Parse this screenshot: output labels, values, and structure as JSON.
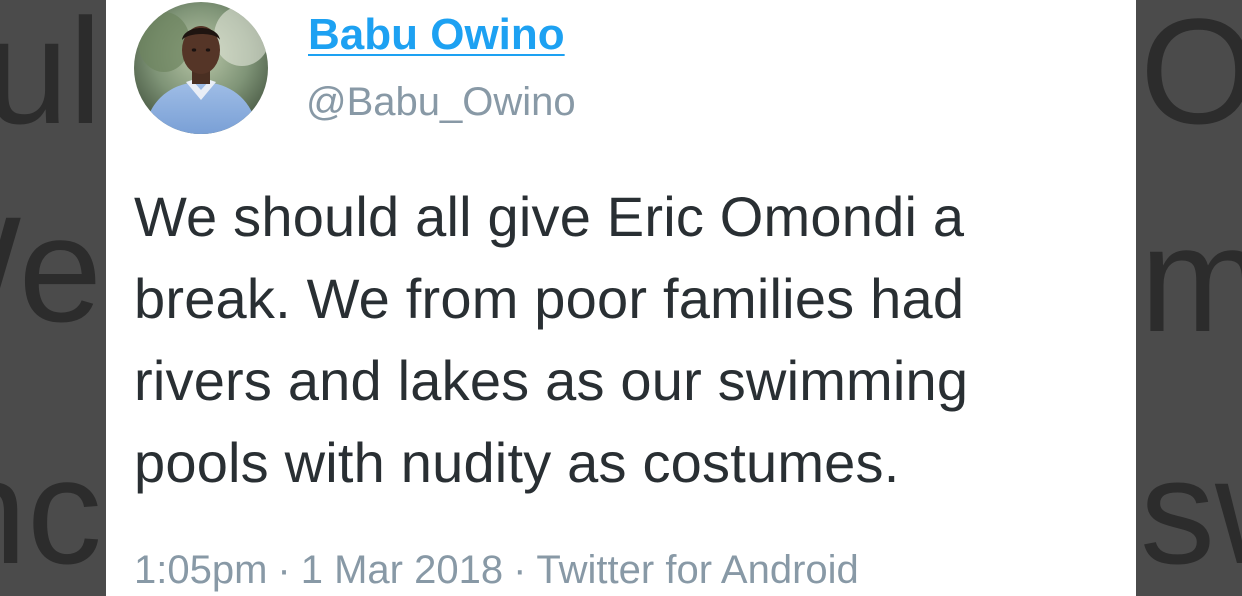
{
  "background": {
    "left_lines": [
      "ul",
      "We",
      "nc"
    ],
    "right_lines": [
      "Om",
      "m",
      "sw"
    ]
  },
  "tweet": {
    "author": {
      "display_name": "Babu Owino",
      "handle": "@Babu_Owino"
    },
    "text_lines": [
      "We should all give Eric Omondi a",
      "break. We from poor families had",
      "rivers and lakes as our swimming",
      "pools with nudity as costumes."
    ],
    "time": "1:05pm",
    "separator": "·",
    "date": "1 Mar 2018",
    "source": "Twitter for Android"
  },
  "colors": {
    "link_blue": "#1da1f2",
    "text_dark": "#292f33",
    "text_muted": "#8899a6",
    "background": "#4b4b4b"
  }
}
